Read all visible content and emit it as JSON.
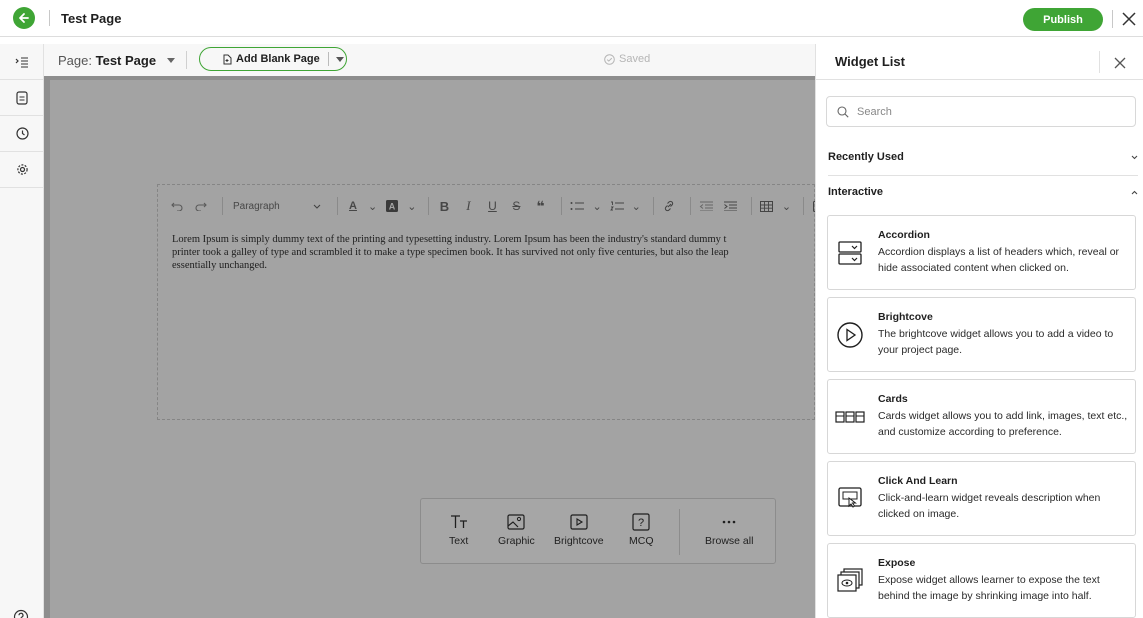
{
  "header": {
    "title": "Test Page",
    "publish_label": "Publish"
  },
  "pagebar": {
    "page_prefix": "Page:",
    "page_name": "Test Page",
    "add_page_label": "Add Blank Page",
    "saved_label": "Saved"
  },
  "editor": {
    "paragraph_style": "Paragraph",
    "lines": [
      "Lorem Ipsum is simply dummy text of the printing and typesetting industry. Lorem Ipsum has been the industry's standard dummy t",
      "printer took a galley of type and scrambled it to make a type specimen book. It has survived not only five centuries, but also the leap",
      "essentially unchanged."
    ]
  },
  "quickbar": {
    "items": [
      {
        "label": "Text",
        "icon": "text-icon"
      },
      {
        "label": "Graphic",
        "icon": "graphic-icon"
      },
      {
        "label": "Brightcove",
        "icon": "brightcove-icon"
      },
      {
        "label": "MCQ",
        "icon": "mcq-icon"
      },
      {
        "label": "Browse all",
        "icon": "more-icon"
      }
    ]
  },
  "panel": {
    "title": "Widget List",
    "search_placeholder": "Search",
    "sections": {
      "recent": "Recently Used",
      "interactive": "Interactive"
    },
    "widgets": [
      {
        "name": "Accordion",
        "desc": "Accordion displays a list of headers which, reveal or hide associated content when clicked on."
      },
      {
        "name": "Brightcove",
        "desc": "The brightcove widget allows you to add a video to your project page."
      },
      {
        "name": "Cards",
        "desc": "Cards widget allows you to add link, images, text etc., and customize according to preference."
      },
      {
        "name": "Click And Learn",
        "desc": "Click-and-learn widget reveals description when clicked on image."
      },
      {
        "name": "Expose",
        "desc": "Expose widget allows learner to expose the text behind the image by shrinking image into half."
      }
    ]
  },
  "colors": {
    "accent": "#3fa535",
    "overlay": "#a3a3a3"
  }
}
